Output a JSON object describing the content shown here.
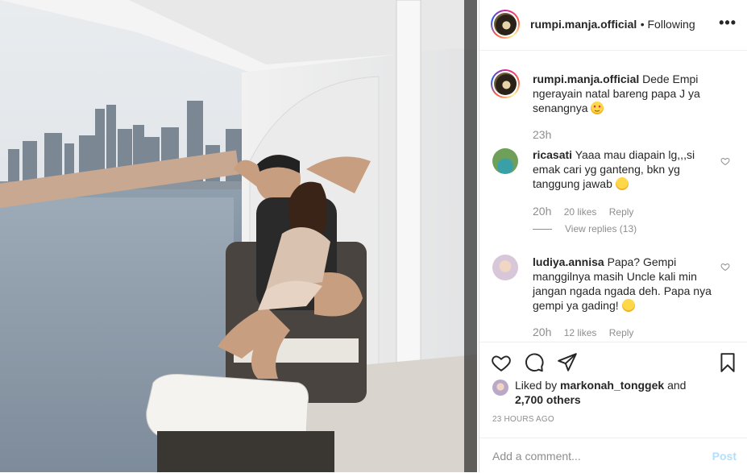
{
  "post": {
    "username": "rumpi.manja.official",
    "follow_status": "• Following",
    "more_label": "•••"
  },
  "caption": {
    "username": "rumpi.manja.official",
    "text": "Dede Empi ngerayain natal bareng papa J ya senangnya",
    "time": "23h"
  },
  "comments": [
    {
      "username": "ricasati",
      "text": "Yaaa mau diapain lg,,,si emak cari yg ganteng, bkn yg tanggung jawab",
      "time": "20h",
      "likes": "20 likes",
      "reply": "Reply",
      "view_replies": "View replies (13)"
    },
    {
      "username": "ludiya.annisa",
      "text": "Papa? Gempi manggilnya masih Uncle kali min jangan ngada ngada deh. Papa nya gempi ya gading!",
      "time": "20h",
      "likes": "12 likes",
      "reply": "Reply"
    }
  ],
  "likes_line": {
    "prefix": "Liked by",
    "user": "markonah_tonggek",
    "and": "and",
    "others": "2,700 others"
  },
  "timestamp": "23 HOURS AGO",
  "add_comment": {
    "placeholder": "Add a comment...",
    "post_label": "Post"
  },
  "icons": {
    "like": "heart-icon",
    "comment": "comment-icon",
    "share": "share-icon",
    "save": "bookmark-icon",
    "more": "more-options-icon"
  }
}
